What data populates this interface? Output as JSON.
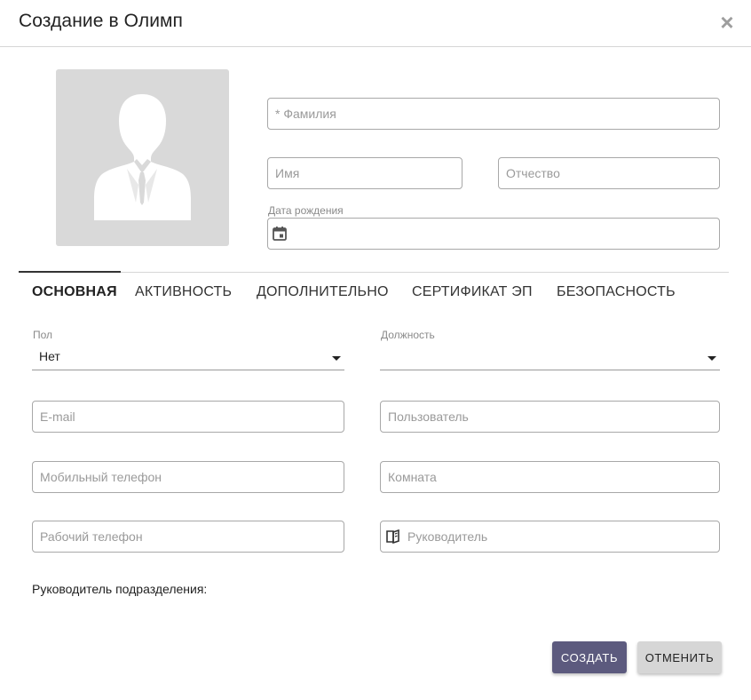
{
  "dialog": {
    "title": "Создание в Олимп",
    "close_symbol": "×"
  },
  "person": {
    "surname_placeholder": "* Фамилия",
    "name_placeholder": "Имя",
    "patronymic_placeholder": "Отчество",
    "birth_date_label": "Дата рождения",
    "birth_date_value": ""
  },
  "tabs": [
    {
      "label": "ОСНОВНАЯ",
      "active": true
    },
    {
      "label": "АКТИВНОСТЬ",
      "active": false
    },
    {
      "label": "ДОПОЛНИТЕЛЬНО",
      "active": false
    },
    {
      "label": "СЕРТИФИКАТ ЭП",
      "active": false
    },
    {
      "label": "БЕЗОПАСНОСТЬ",
      "active": false
    }
  ],
  "main": {
    "gender_label": "Пол",
    "gender_value": "Нет",
    "position_label": "Должность",
    "position_value": "",
    "email_placeholder": "E-mail",
    "user_placeholder": "Пользователь",
    "mobile_placeholder": "Мобильный телефон",
    "room_placeholder": "Комната",
    "work_phone_placeholder": "Рабочий телефон",
    "manager_placeholder": "Руководитель",
    "dept_head_label": "Руководитель подразделения:"
  },
  "actions": {
    "create_label": "СОЗДАТЬ",
    "cancel_label": "ОТМЕНИТЬ"
  },
  "icons": {
    "close": "close-icon",
    "calendar": "calendar-icon",
    "book": "address-book-icon",
    "avatar": "user-silhouette-icon"
  },
  "colors": {
    "primary_button": "#5c5a7e",
    "secondary_button": "#d6d6d6",
    "avatar_bg": "#d9d9d9"
  }
}
